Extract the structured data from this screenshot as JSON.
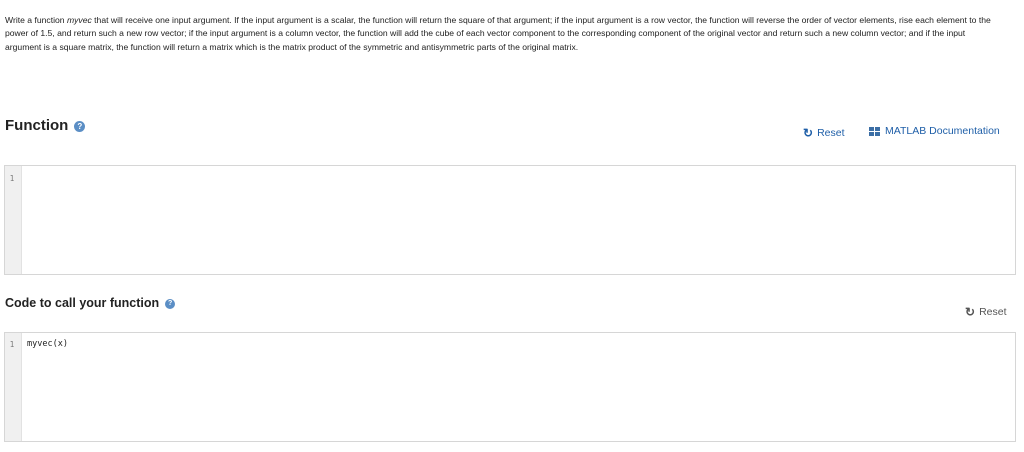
{
  "problem": {
    "prefix": "Write a function ",
    "function_name": "myvec",
    "text": " that will receive one input argument. If the input argument is a scalar, the function will return the square of that argument; if the input argument is a row vector, the function will reverse the order of vector elements, rise each element to the power of 1.5, and return such a new row vector; if the input argument is a column vector, the function will add the cube of each vector component to the corresponding component of the original vector and return such a new column vector; and if the input argument is a square matrix, the function will return a matrix which is the matrix product of the symmetric and antisymmetric parts of the original matrix."
  },
  "function_section": {
    "title": "Function",
    "help_glyph": "?",
    "reset_label": "Reset",
    "docs_label": "MATLAB Documentation",
    "editor": {
      "line_number": "1",
      "code": ""
    }
  },
  "call_section": {
    "title": "Code to call your function",
    "help_glyph": "?",
    "reset_label": "Reset",
    "editor": {
      "line_number": "1",
      "code": "myvec(x)"
    }
  },
  "icons": {
    "help": "question-circle-icon",
    "reset": "refresh-icon",
    "docs": "matlab-doc-icon"
  },
  "colors": {
    "link": "#1f5fa8",
    "help_icon": "#5b8ec5",
    "editor_border": "#d6d6d6",
    "gutter": "#f0f0f0"
  }
}
